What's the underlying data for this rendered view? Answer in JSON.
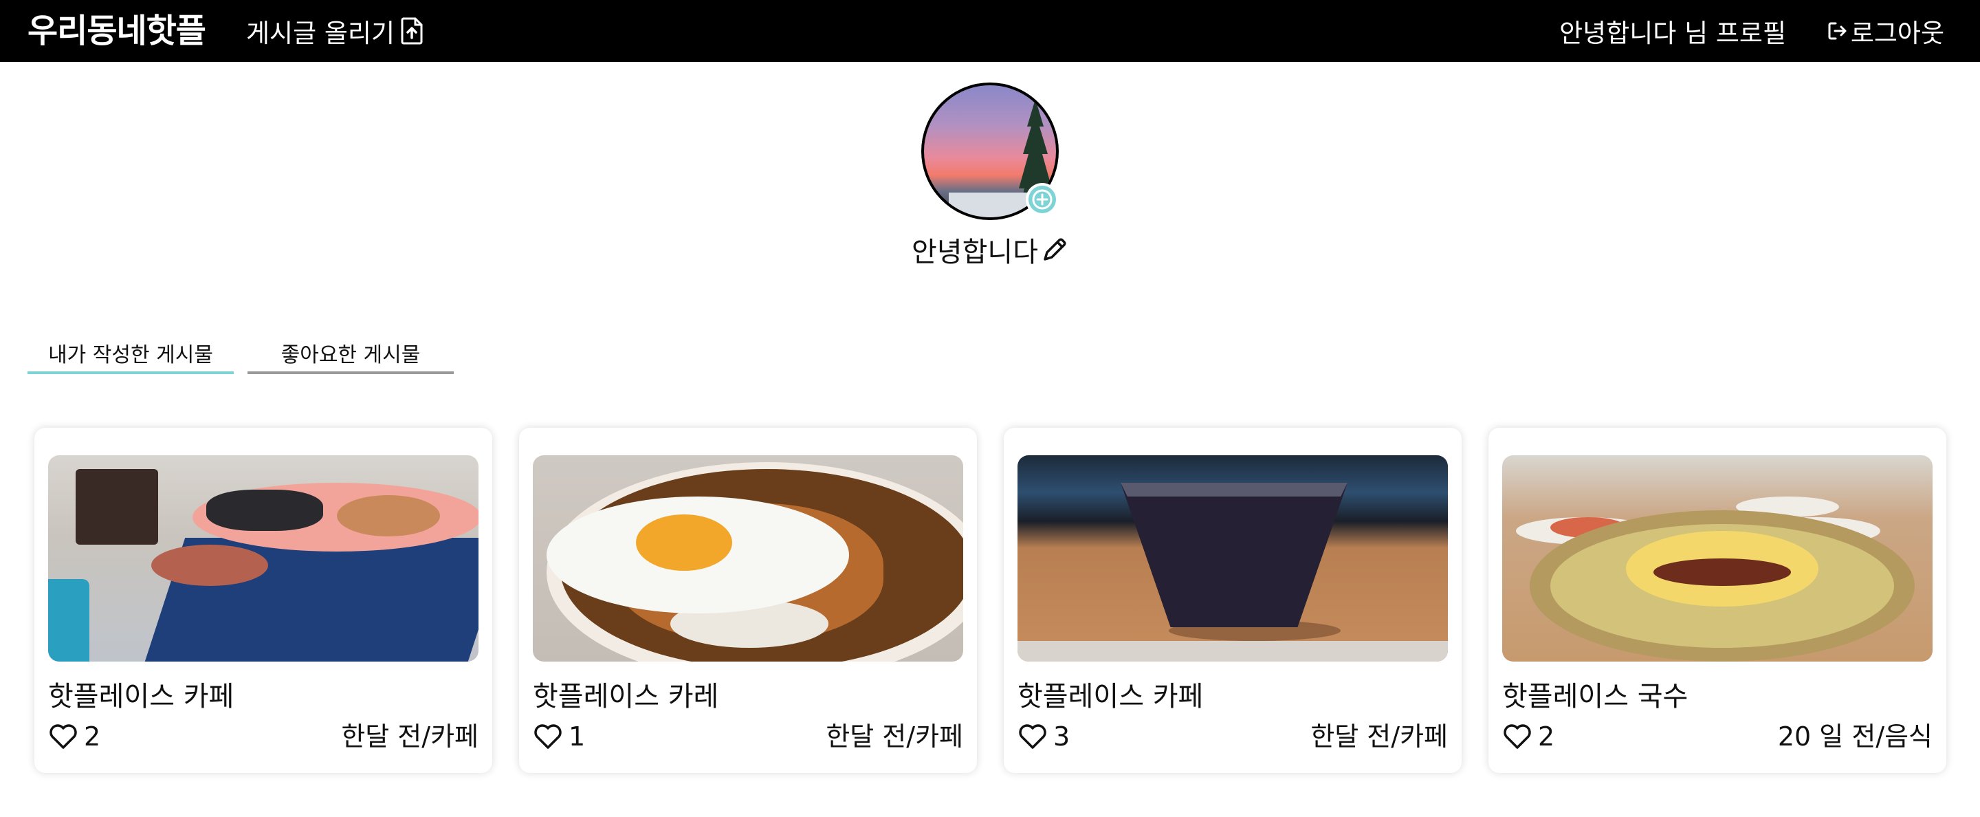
{
  "header": {
    "brand": "우리동네핫플",
    "upload_label": "게시글 올리기",
    "profile_label": "안녕합니다 님 프로필",
    "logout_label": "로그아웃"
  },
  "profile": {
    "nickname": "안녕합니다"
  },
  "tabs": [
    {
      "label": "내가 작성한 게시물",
      "active": true
    },
    {
      "label": "좋아요한 게시물",
      "active": false
    }
  ],
  "colors": {
    "topbar": "#000000",
    "accent": "#7dd3d6",
    "tab_inactive": "#9a9a9a"
  },
  "icons": {
    "upload": "file-upload-icon",
    "logout": "logout-icon",
    "add_photo": "plus-circle-icon",
    "edit": "pencil-icon",
    "like": "heart-icon"
  },
  "posts": [
    {
      "title": "핫플레이스 카페",
      "likes": "2",
      "meta": "한달 전/카페"
    },
    {
      "title": "핫플레이스 카레",
      "likes": "1",
      "meta": "한달 전/카페"
    },
    {
      "title": "핫플레이스 카페",
      "likes": "3",
      "meta": "한달 전/카페"
    },
    {
      "title": "핫플레이스 국수",
      "likes": "2",
      "meta": "20 일 전/음식"
    }
  ]
}
